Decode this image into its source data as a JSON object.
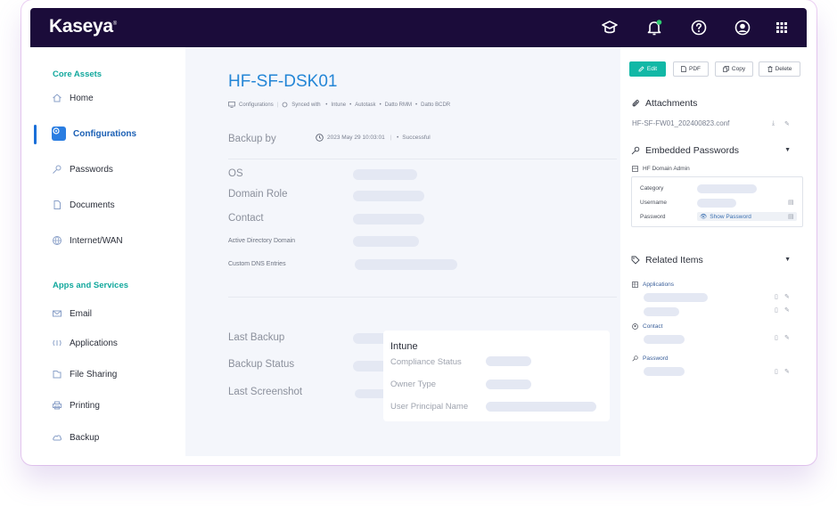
{
  "brand": {
    "name": "Kaseya",
    "mark": "®"
  },
  "topbar": {
    "icons": [
      "graduation-cap-icon",
      "bell-icon",
      "help-icon",
      "user-icon",
      "apps-grid-icon"
    ],
    "notification_dot_color": "#2ecc71"
  },
  "sidebar": {
    "core_section": "Core Assets",
    "core_items": [
      {
        "label": "Home",
        "icon": "home-icon"
      },
      {
        "label": "Configurations",
        "icon": "gear-icon",
        "active": true
      },
      {
        "label": "Passwords",
        "icon": "key-icon"
      },
      {
        "label": "Documents",
        "icon": "document-icon"
      },
      {
        "label": "Internet/WAN",
        "icon": "globe-icon"
      }
    ],
    "apps_section": "Apps and Services",
    "apps_items": [
      {
        "label": "Email",
        "icon": "mail-icon"
      },
      {
        "label": "Applications",
        "icon": "applications-icon"
      },
      {
        "label": "File Sharing",
        "icon": "folder-icon"
      },
      {
        "label": "Printing",
        "icon": "printer-icon"
      },
      {
        "label": "Backup",
        "icon": "cloud-backup-icon"
      }
    ]
  },
  "main": {
    "title": "HF-SF-DSK01",
    "meta": {
      "breadcrumb": "Configurations",
      "synced_label": "Synced with",
      "synced_with": [
        "Intune",
        "Autotask",
        "Datto RMM",
        "Datto BCDR"
      ]
    },
    "backup_by": {
      "label": "Backup by",
      "timestamp": "2023 May 29 10:03:01",
      "status": "Successful"
    },
    "fields": {
      "os": "OS",
      "domain_role": "Domain Role",
      "contact": "Contact",
      "ad_domain": "Active Directory Domain",
      "dns": "Custom DNS Entries"
    },
    "backup_fields": {
      "last_backup": "Last Backup",
      "backup_status": "Backup Status",
      "last_screenshot": "Last Screenshot"
    },
    "intune": {
      "title": "Intune",
      "compliance": "Compliance Status",
      "owner": "Owner Type",
      "upn": "User Principal Name"
    }
  },
  "right": {
    "buttons": {
      "edit": "Edit",
      "pdf": "PDF",
      "copy": "Copy",
      "delete": "Delete"
    },
    "attachments": {
      "title": "Attachments",
      "file": "HF-SF-FW01_202400823.conf"
    },
    "embedded": {
      "title": "Embedded Passwords",
      "entry": "HF Domain Admin",
      "category": "Category",
      "username": "Username",
      "password": "Password",
      "show_password": "Show Password"
    },
    "related": {
      "title": "Related Items",
      "applications": "Applications",
      "contact": "Contact",
      "password": "Password"
    }
  }
}
